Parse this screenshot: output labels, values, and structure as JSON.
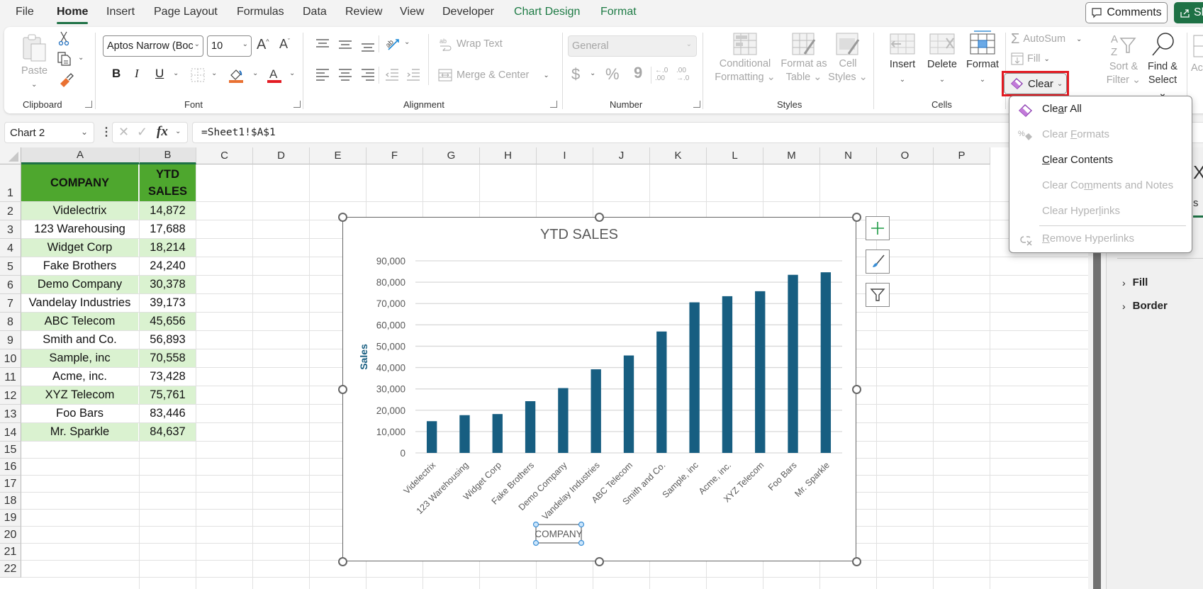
{
  "ribbon_tabs": [
    {
      "label": "File",
      "active": false,
      "contextual": false
    },
    {
      "label": "Home",
      "active": true,
      "contextual": false
    },
    {
      "label": "Insert",
      "active": false,
      "contextual": false
    },
    {
      "label": "Page Layout",
      "active": false,
      "contextual": false
    },
    {
      "label": "Formulas",
      "active": false,
      "contextual": false
    },
    {
      "label": "Data",
      "active": false,
      "contextual": false
    },
    {
      "label": "Review",
      "active": false,
      "contextual": false
    },
    {
      "label": "View",
      "active": false,
      "contextual": false
    },
    {
      "label": "Developer",
      "active": false,
      "contextual": false
    },
    {
      "label": "Chart Design",
      "active": false,
      "contextual": true
    },
    {
      "label": "Format",
      "active": false,
      "contextual": true
    }
  ],
  "top_right": {
    "comments_label": "Comments",
    "share_label": "Sh"
  },
  "ribbon": {
    "clipboard": {
      "paste_label": "Paste",
      "group_label": "Clipboard"
    },
    "font": {
      "font_name": "Aptos Narrow (Boc",
      "font_size": "10",
      "group_label": "Font",
      "fill_color": "#e97132",
      "font_color": "#e31b23"
    },
    "alignment": {
      "wrap_text_label": "Wrap Text",
      "merge_center_label": "Merge & Center",
      "group_label": "Alignment"
    },
    "number": {
      "format_value": "General",
      "group_label": "Number",
      "currency_symbol": "$",
      "percent_symbol": "%",
      "comma_symbol": "9"
    },
    "styles": {
      "conditional_formatting_line1": "Conditional",
      "conditional_formatting_line2": "Formatting",
      "format_as_table_line1": "Format as",
      "format_as_table_line2": "Table",
      "cell_styles_line1": "Cell",
      "cell_styles_line2": "Styles",
      "group_label": "Styles"
    },
    "cells": {
      "insert_label": "Insert",
      "delete_label": "Delete",
      "format_label": "Format",
      "group_label": "Cells"
    },
    "editing": {
      "autosum_label": "AutoSum",
      "fill_label": "Fill",
      "clear_label": "Clear",
      "sort_filter_line1": "Sort &",
      "sort_filter_line2": "Filter",
      "find_select_line1": "Find &",
      "find_select_line2": "Select",
      "next_group_partial": "Ac"
    }
  },
  "formula_bar": {
    "name_box": "Chart 2",
    "formula": "=Sheet1!$A$1",
    "fx_label": "fx"
  },
  "columns": [
    "A",
    "B",
    "C",
    "D",
    "E",
    "F",
    "G",
    "H",
    "I",
    "J",
    "K",
    "L",
    "M",
    "N",
    "O",
    "P"
  ],
  "rows": [
    "1",
    "2",
    "3",
    "4",
    "5",
    "6",
    "7",
    "8",
    "9",
    "10",
    "11",
    "12",
    "13",
    "14",
    "15",
    "16",
    "17",
    "18",
    "19",
    "20",
    "21",
    "22"
  ],
  "table": {
    "headers": {
      "company": "COMPANY",
      "sales_line1": "YTD",
      "sales_line2": "SALES"
    },
    "rows": [
      {
        "company": "Videlectrix",
        "sales": "14,872"
      },
      {
        "company": "123 Warehousing",
        "sales": "17,688"
      },
      {
        "company": "Widget Corp",
        "sales": "18,214"
      },
      {
        "company": "Fake Brothers",
        "sales": "24,240"
      },
      {
        "company": "Demo Company",
        "sales": "30,378"
      },
      {
        "company": "Vandelay Industries",
        "sales": "39,173"
      },
      {
        "company": "ABC Telecom",
        "sales": "45,656"
      },
      {
        "company": "Smith and Co.",
        "sales": "56,893"
      },
      {
        "company": "Sample, inc",
        "sales": "70,558"
      },
      {
        "company": "Acme, inc.",
        "sales": "73,428"
      },
      {
        "company": "XYZ Telecom",
        "sales": "75,761"
      },
      {
        "company": "Foo Bars",
        "sales": "83,446"
      },
      {
        "company": "Mr. Sparkle",
        "sales": "84,637"
      }
    ],
    "header_color": "#4ea72e",
    "band_color": "#daf2d0"
  },
  "chart_data": {
    "type": "bar",
    "title": "YTD SALES",
    "xlabel": "COMPANY",
    "ylabel": "Sales",
    "categories": [
      "Videlectrix",
      "123 Warehousing",
      "Widget Corp",
      "Fake Brothers",
      "Demo Company",
      "Vandelay Industries",
      "ABC Telecom",
      "Smith and Co.",
      "Sample, inc",
      "Acme, inc.",
      "XYZ Telecom",
      "Foo Bars",
      "Mr. Sparkle"
    ],
    "values": [
      14872,
      17688,
      18214,
      24240,
      30378,
      39173,
      45656,
      56893,
      70558,
      73428,
      75761,
      83446,
      84637
    ],
    "ylim": [
      0,
      90000
    ],
    "yticks": [
      0,
      10000,
      20000,
      30000,
      40000,
      50000,
      60000,
      70000,
      80000,
      90000
    ],
    "ytick_labels": [
      "0",
      "10,000",
      "20,000",
      "30,000",
      "40,000",
      "50,000",
      "60,000",
      "70,000",
      "80,000",
      "90,000"
    ],
    "grid": true,
    "legend": "none",
    "bar_color": "#175e81"
  },
  "clear_menu": {
    "items": [
      {
        "label_pre": "Cle",
        "label_u": "a",
        "label_post": "r All",
        "enabled": true,
        "icon": "eraser-icon"
      },
      {
        "label_pre": "Clear ",
        "label_u": "F",
        "label_post": "ormats",
        "enabled": false,
        "icon": "clear-formats-icon"
      },
      {
        "label_pre": "",
        "label_u": "C",
        "label_post": "lear Contents",
        "enabled": true,
        "icon": ""
      },
      {
        "label_pre": "Clear Co",
        "label_u": "m",
        "label_post": "ments and Notes",
        "enabled": false,
        "icon": ""
      },
      {
        "label_pre": "Clear Hyper",
        "label_u": "l",
        "label_post": "inks",
        "enabled": false,
        "icon": ""
      },
      {
        "label_pre": "",
        "label_u": "R",
        "label_post": "emove Hyperlinks",
        "enabled": false,
        "icon": "remove-hyperlink-icon"
      }
    ]
  },
  "format_pane": {
    "title_partial": "Xi",
    "tab_partial": "s",
    "sections": [
      {
        "label": "Fill"
      },
      {
        "label": "Border"
      }
    ]
  }
}
